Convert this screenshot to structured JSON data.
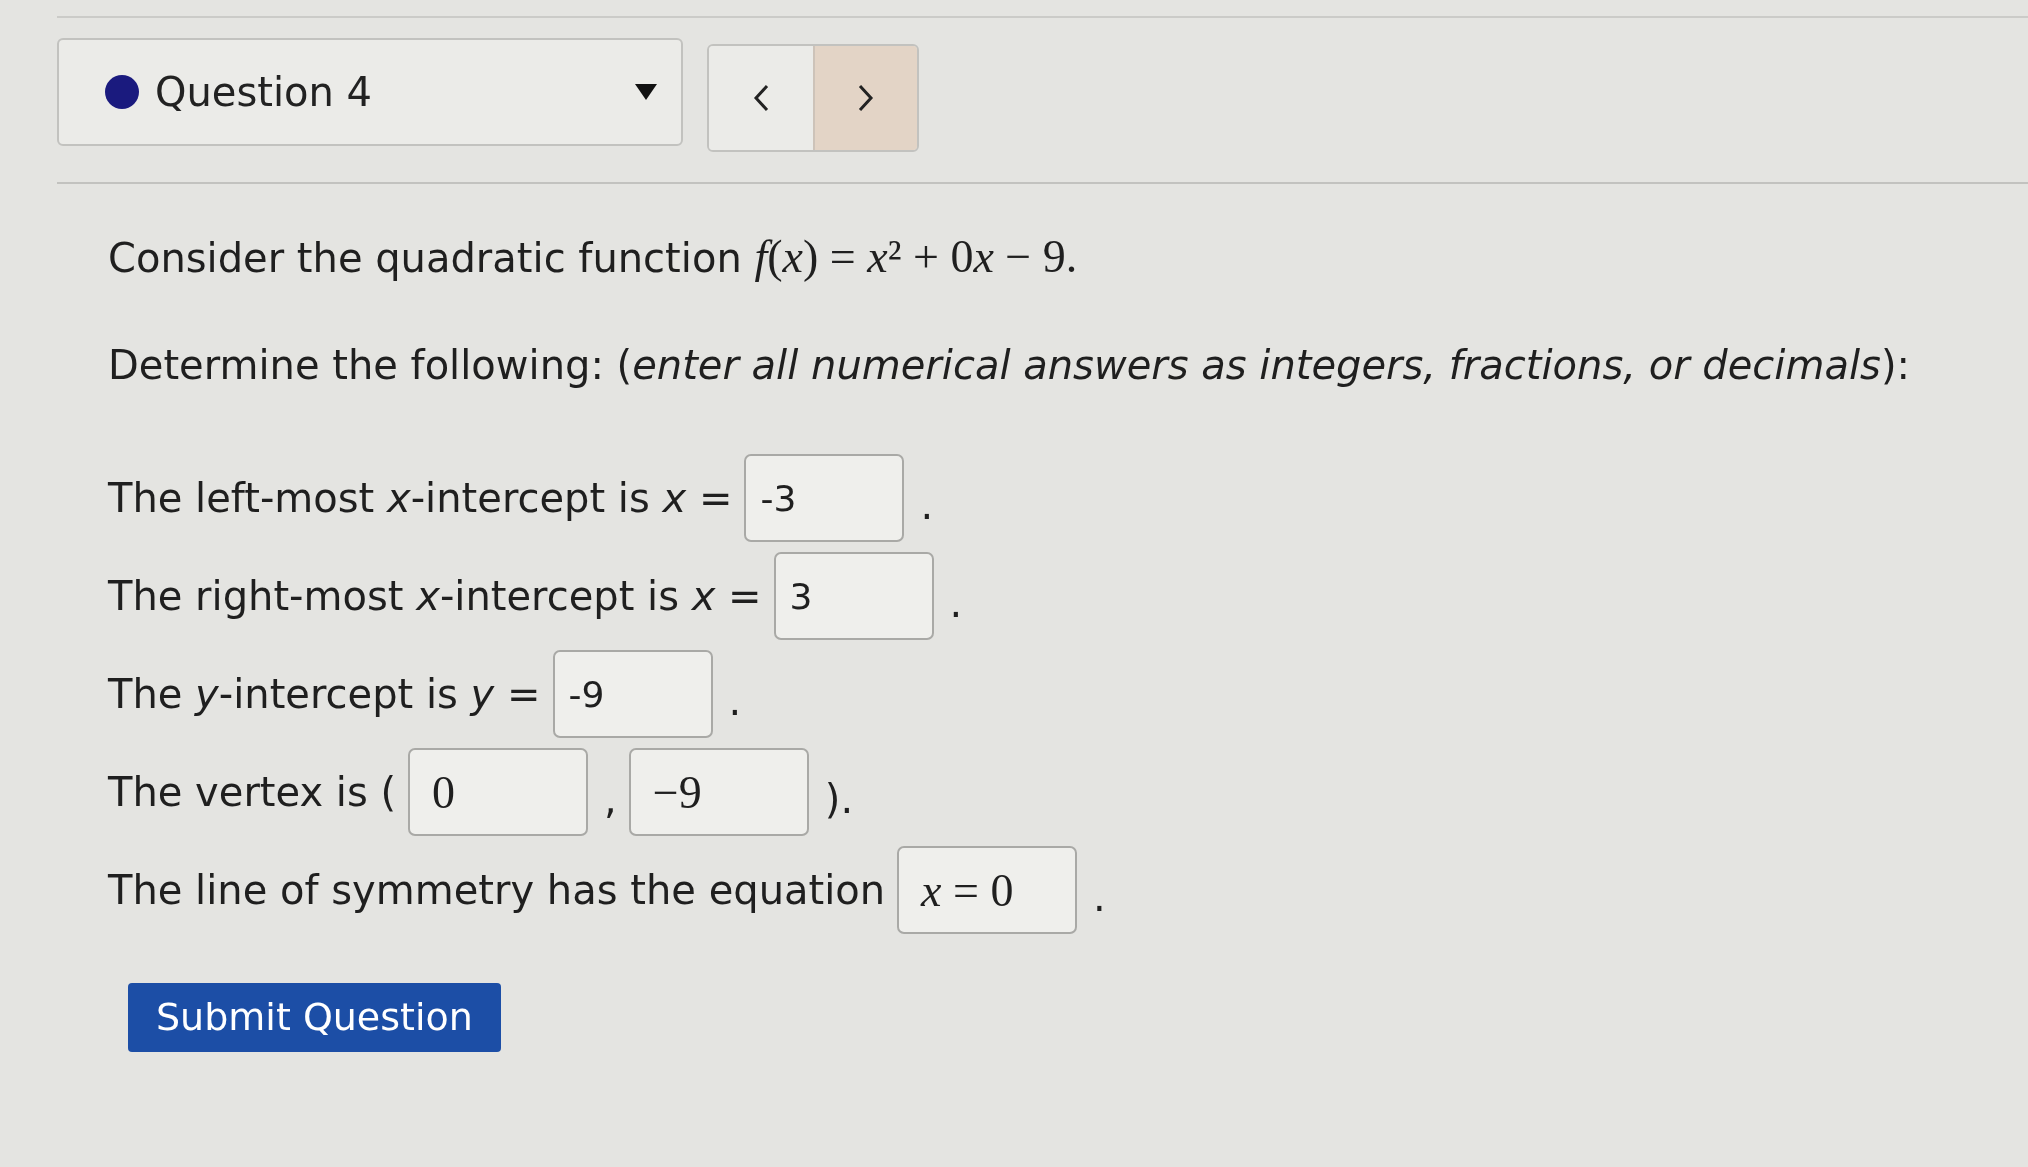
{
  "question_select": {
    "label": "Question 4"
  },
  "prompt": {
    "parts": [
      {
        "kind": "text",
        "text": "Consider the quadratic function"
      },
      {
        "kind": "math",
        "text": "f(x) = x² + 0x − 9."
      }
    ]
  },
  "instructions": "Determine the following: (*enter all numerical answers as integers, fractions, or decimals*):",
  "answer_lines": [
    {
      "parts": [
        {
          "kind": "text",
          "text": "The left-most *x*-intercept is *x* ="
        },
        {
          "kind": "input",
          "value": "-3"
        },
        {
          "kind": "punctuation",
          "text": "."
        }
      ]
    },
    {
      "parts": [
        {
          "kind": "text",
          "text": "The right-most *x*-intercept is *x* ="
        },
        {
          "kind": "input",
          "value": "3"
        },
        {
          "kind": "punctuation",
          "text": "."
        }
      ]
    },
    {
      "parts": [
        {
          "kind": "text",
          "text": "The *y*-intercept is *y* ="
        },
        {
          "kind": "input",
          "value": "-9"
        },
        {
          "kind": "punctuation",
          "text": "."
        }
      ]
    },
    {
      "parts": [
        {
          "kind": "text",
          "text": "The vertex is ("
        },
        {
          "kind": "math_input",
          "value": "0"
        },
        {
          "kind": "punctuation",
          "text": ","
        },
        {
          "kind": "math_input",
          "value": "−9"
        },
        {
          "kind": "punctuation",
          "text": ")."
        }
      ]
    },
    {
      "parts": [
        {
          "kind": "text",
          "text": "The line of symmetry has the equation"
        },
        {
          "kind": "math_input",
          "value": "x = 0"
        },
        {
          "kind": "punctuation",
          "text": "."
        }
      ]
    }
  ],
  "submit_button": "Submit Question"
}
